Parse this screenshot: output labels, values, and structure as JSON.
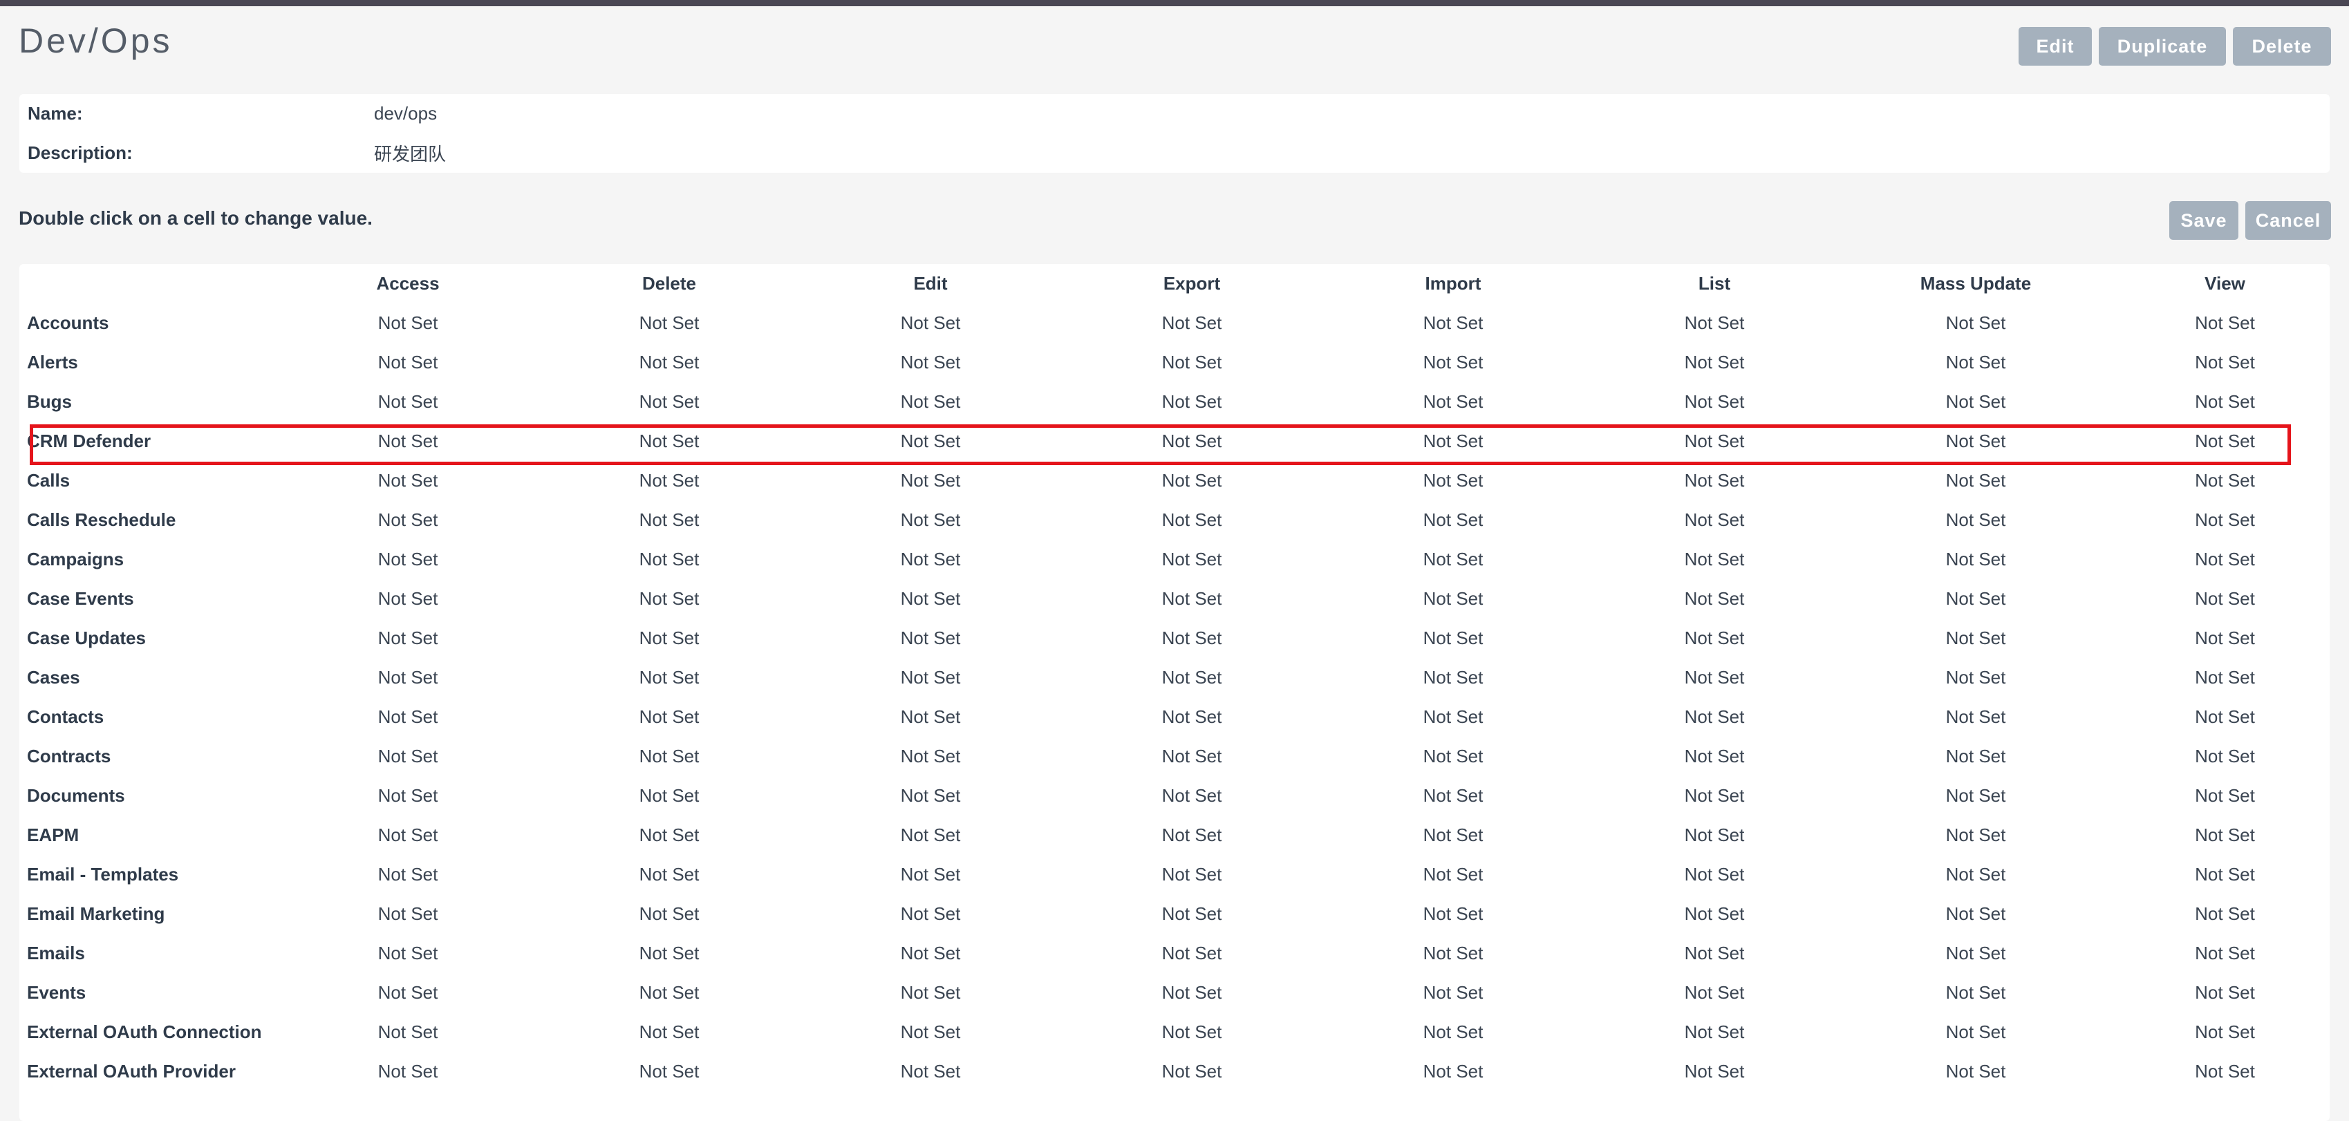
{
  "page": {
    "title": "Dev/Ops"
  },
  "header_actions": {
    "edit": "Edit",
    "duplicate": "Duplicate",
    "delete": "Delete"
  },
  "details": {
    "name_label": "Name:",
    "name_value": "dev/ops",
    "description_label": "Description:",
    "description_value": "研发团队"
  },
  "instruction": "Double click on a cell to change value.",
  "table_actions": {
    "save": "Save",
    "cancel": "Cancel"
  },
  "acl_table": {
    "columns": [
      "",
      "Access",
      "Delete",
      "Edit",
      "Export",
      "Import",
      "List",
      "Mass Update",
      "View"
    ],
    "highlighted_row": "CRM Defender",
    "rows": [
      {
        "module": "Accounts",
        "values": [
          "Not Set",
          "Not Set",
          "Not Set",
          "Not Set",
          "Not Set",
          "Not Set",
          "Not Set",
          "Not Set"
        ]
      },
      {
        "module": "Alerts",
        "values": [
          "Not Set",
          "Not Set",
          "Not Set",
          "Not Set",
          "Not Set",
          "Not Set",
          "Not Set",
          "Not Set"
        ]
      },
      {
        "module": "Bugs",
        "values": [
          "Not Set",
          "Not Set",
          "Not Set",
          "Not Set",
          "Not Set",
          "Not Set",
          "Not Set",
          "Not Set"
        ]
      },
      {
        "module": "CRM Defender",
        "values": [
          "Not Set",
          "Not Set",
          "Not Set",
          "Not Set",
          "Not Set",
          "Not Set",
          "Not Set",
          "Not Set"
        ]
      },
      {
        "module": "Calls",
        "values": [
          "Not Set",
          "Not Set",
          "Not Set",
          "Not Set",
          "Not Set",
          "Not Set",
          "Not Set",
          "Not Set"
        ]
      },
      {
        "module": "Calls Reschedule",
        "values": [
          "Not Set",
          "Not Set",
          "Not Set",
          "Not Set",
          "Not Set",
          "Not Set",
          "Not Set",
          "Not Set"
        ]
      },
      {
        "module": "Campaigns",
        "values": [
          "Not Set",
          "Not Set",
          "Not Set",
          "Not Set",
          "Not Set",
          "Not Set",
          "Not Set",
          "Not Set"
        ]
      },
      {
        "module": "Case Events",
        "values": [
          "Not Set",
          "Not Set",
          "Not Set",
          "Not Set",
          "Not Set",
          "Not Set",
          "Not Set",
          "Not Set"
        ]
      },
      {
        "module": "Case Updates",
        "values": [
          "Not Set",
          "Not Set",
          "Not Set",
          "Not Set",
          "Not Set",
          "Not Set",
          "Not Set",
          "Not Set"
        ]
      },
      {
        "module": "Cases",
        "values": [
          "Not Set",
          "Not Set",
          "Not Set",
          "Not Set",
          "Not Set",
          "Not Set",
          "Not Set",
          "Not Set"
        ]
      },
      {
        "module": "Contacts",
        "values": [
          "Not Set",
          "Not Set",
          "Not Set",
          "Not Set",
          "Not Set",
          "Not Set",
          "Not Set",
          "Not Set"
        ]
      },
      {
        "module": "Contracts",
        "values": [
          "Not Set",
          "Not Set",
          "Not Set",
          "Not Set",
          "Not Set",
          "Not Set",
          "Not Set",
          "Not Set"
        ]
      },
      {
        "module": "Documents",
        "values": [
          "Not Set",
          "Not Set",
          "Not Set",
          "Not Set",
          "Not Set",
          "Not Set",
          "Not Set",
          "Not Set"
        ]
      },
      {
        "module": "EAPM",
        "values": [
          "Not Set",
          "Not Set",
          "Not Set",
          "Not Set",
          "Not Set",
          "Not Set",
          "Not Set",
          "Not Set"
        ]
      },
      {
        "module": "Email - Templates",
        "values": [
          "Not Set",
          "Not Set",
          "Not Set",
          "Not Set",
          "Not Set",
          "Not Set",
          "Not Set",
          "Not Set"
        ]
      },
      {
        "module": "Email Marketing",
        "values": [
          "Not Set",
          "Not Set",
          "Not Set",
          "Not Set",
          "Not Set",
          "Not Set",
          "Not Set",
          "Not Set"
        ]
      },
      {
        "module": "Emails",
        "values": [
          "Not Set",
          "Not Set",
          "Not Set",
          "Not Set",
          "Not Set",
          "Not Set",
          "Not Set",
          "Not Set"
        ]
      },
      {
        "module": "Events",
        "values": [
          "Not Set",
          "Not Set",
          "Not Set",
          "Not Set",
          "Not Set",
          "Not Set",
          "Not Set",
          "Not Set"
        ]
      },
      {
        "module": "External OAuth Connection",
        "values": [
          "Not Set",
          "Not Set",
          "Not Set",
          "Not Set",
          "Not Set",
          "Not Set",
          "Not Set",
          "Not Set"
        ]
      },
      {
        "module": "External OAuth Provider",
        "values": [
          "Not Set",
          "Not Set",
          "Not Set",
          "Not Set",
          "Not Set",
          "Not Set",
          "Not Set",
          "Not Set"
        ]
      }
    ]
  },
  "colors": {
    "button_bg": "#a5b1bd",
    "highlight_border": "#e5141b",
    "top_strip": "#4a4754",
    "page_bg": "#f5f5f5"
  }
}
